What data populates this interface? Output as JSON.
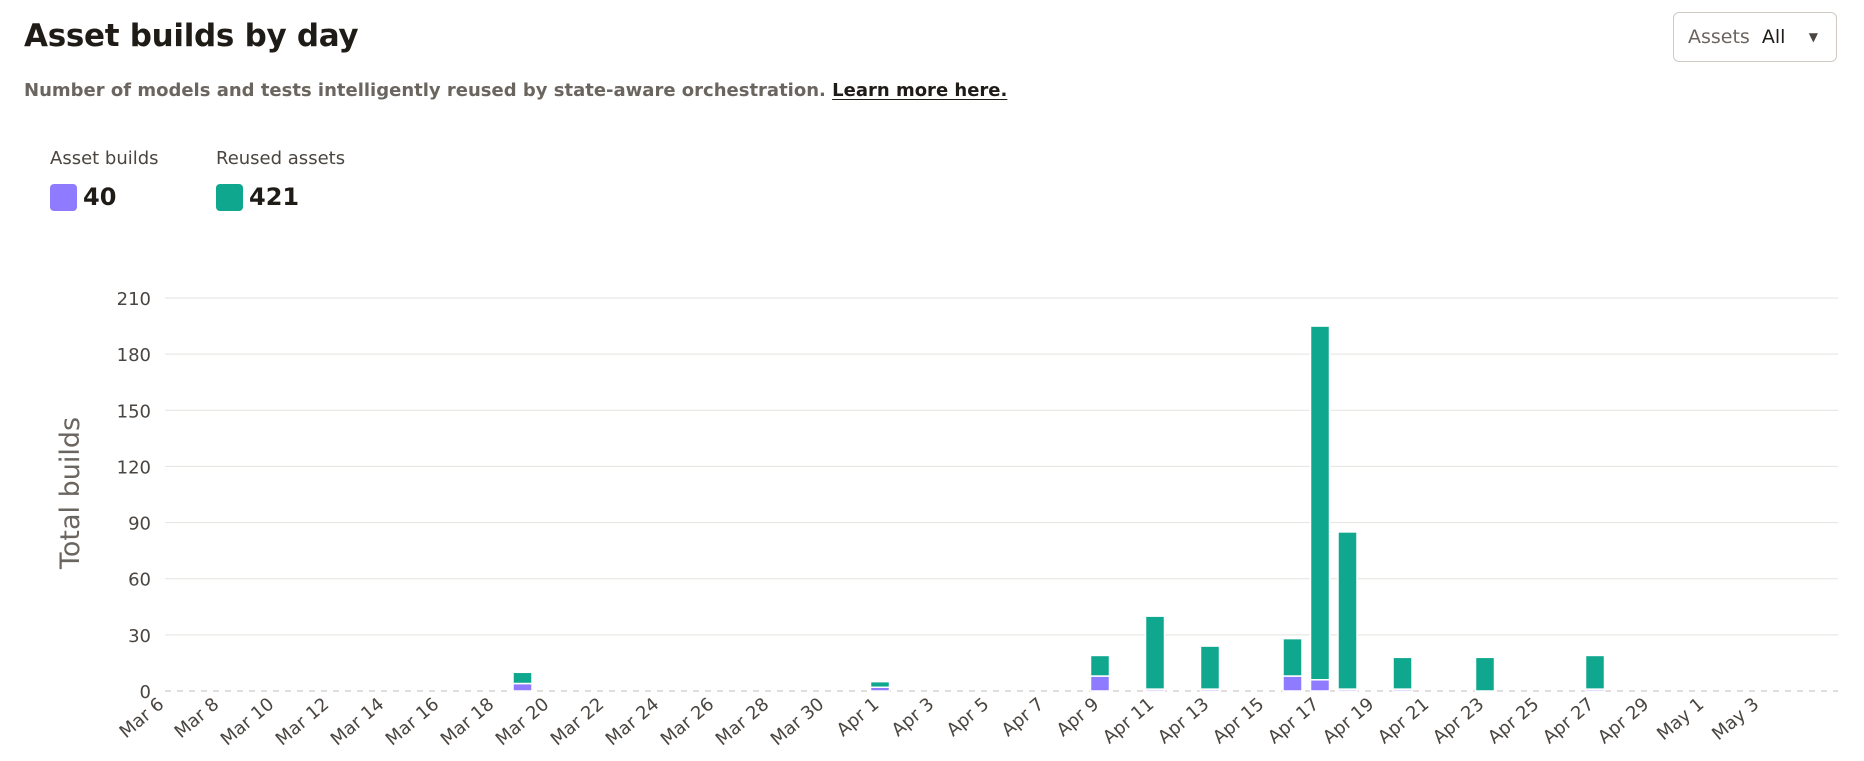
{
  "header": {
    "title": "Asset builds by day",
    "subtitle": "Number of models and tests intelligently reused by state-aware orchestration.",
    "learn_more": "Learn more here."
  },
  "filter": {
    "label": "Assets",
    "value": "All"
  },
  "colors": {
    "asset_builds": "#8f7bff",
    "reused_assets": "#0fa88f",
    "grid": "#e6e3df"
  },
  "legend": [
    {
      "name": "Asset builds",
      "total": "40",
      "color": "#8f7bff"
    },
    {
      "name": "Reused assets",
      "total": "421",
      "color": "#0fa88f"
    }
  ],
  "chart_data": {
    "type": "bar",
    "stacked": true,
    "ylabel": "Total builds",
    "ylim": [
      0,
      210
    ],
    "yticks": [
      0,
      30,
      60,
      90,
      120,
      150,
      180,
      210
    ],
    "grid": true,
    "x_labels": [
      "Mar 6",
      "Mar 8",
      "Mar 10",
      "Mar 12",
      "Mar 14",
      "Mar 16",
      "Mar 18",
      "Mar 20",
      "Mar 22",
      "Mar 24",
      "Mar 26",
      "Mar 28",
      "Mar 30",
      "Apr 1",
      "Apr 3",
      "Apr 5",
      "Apr 7",
      "Apr 9",
      "Apr 11",
      "Apr 13",
      "Apr 15",
      "Apr 17",
      "Apr 19",
      "Apr 21",
      "Apr 23",
      "Apr 25",
      "Apr 27",
      "Apr 29",
      "May 1",
      "May 3"
    ],
    "series": [
      {
        "name": "Asset builds",
        "color": "#8f7bff",
        "points": [
          {
            "date": "Mar 19",
            "value": 4
          },
          {
            "date": "Apr 1",
            "value": 2
          },
          {
            "date": "Apr 9",
            "value": 8
          },
          {
            "date": "Apr 11",
            "value": 1
          },
          {
            "date": "Apr 13",
            "value": 1
          },
          {
            "date": "Apr 16",
            "value": 8
          },
          {
            "date": "Apr 17",
            "value": 6
          },
          {
            "date": "Apr 18",
            "value": 1
          },
          {
            "date": "Apr 20",
            "value": 1
          },
          {
            "date": "Apr 27",
            "value": 1
          }
        ]
      },
      {
        "name": "Reused assets",
        "color": "#0fa88f",
        "points": [
          {
            "date": "Mar 19",
            "value": 6
          },
          {
            "date": "Apr 1",
            "value": 3
          },
          {
            "date": "Apr 9",
            "value": 11
          },
          {
            "date": "Apr 11",
            "value": 39
          },
          {
            "date": "Apr 13",
            "value": 23
          },
          {
            "date": "Apr 16",
            "value": 20
          },
          {
            "date": "Apr 17",
            "value": 189
          },
          {
            "date": "Apr 18",
            "value": 84
          },
          {
            "date": "Apr 20",
            "value": 17
          },
          {
            "date": "Apr 23",
            "value": 18
          },
          {
            "date": "Apr 27",
            "value": 18
          }
        ]
      }
    ]
  }
}
